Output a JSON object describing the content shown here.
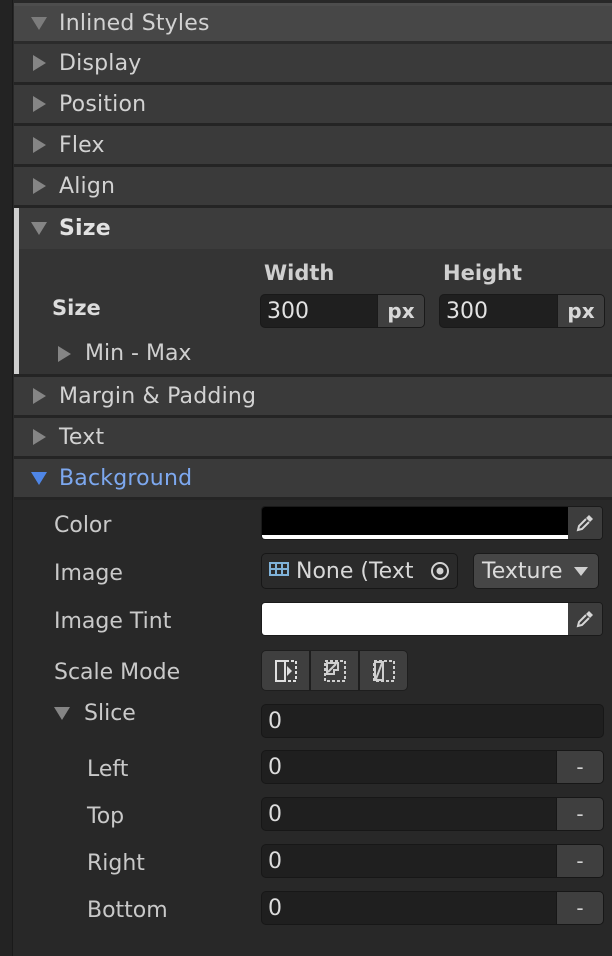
{
  "panel": {
    "inlined_styles_label": "Inlined Styles"
  },
  "sections": {
    "display": "Display",
    "position": "Position",
    "flex": "Flex",
    "align": "Align",
    "size": "Size",
    "margin_padding": "Margin & Padding",
    "text": "Text",
    "background": "Background"
  },
  "size": {
    "row_label": "Size",
    "width_label": "Width",
    "height_label": "Height",
    "width_value": "300",
    "height_value": "300",
    "unit": "px",
    "min_max_label": "Min - Max"
  },
  "background": {
    "color_label": "Color",
    "color_value": "#000000",
    "image_label": "Image",
    "image_value": "None (Text",
    "image_type": "Texture",
    "tint_label": "Image Tint",
    "tint_value": "#ffffff",
    "scale_mode_label": "Scale Mode",
    "scale_mode_selected": 0,
    "slice_label": "Slice",
    "slice_value": "0",
    "slice_fields": [
      {
        "label": "Left",
        "value": "0",
        "keyword": "-"
      },
      {
        "label": "Top",
        "value": "0",
        "keyword": "-"
      },
      {
        "label": "Right",
        "value": "0",
        "keyword": "-"
      },
      {
        "label": "Bottom",
        "value": "0",
        "keyword": "-"
      }
    ]
  },
  "colors": {
    "active_section": "#7da8ef",
    "selected_button": "#46607f"
  },
  "icons": {
    "collapsed": "triangle-right-icon",
    "expanded": "triangle-down-icon",
    "eyedropper": "eyedropper-icon",
    "texture": "texture-icon",
    "object_picker": "target-icon"
  }
}
